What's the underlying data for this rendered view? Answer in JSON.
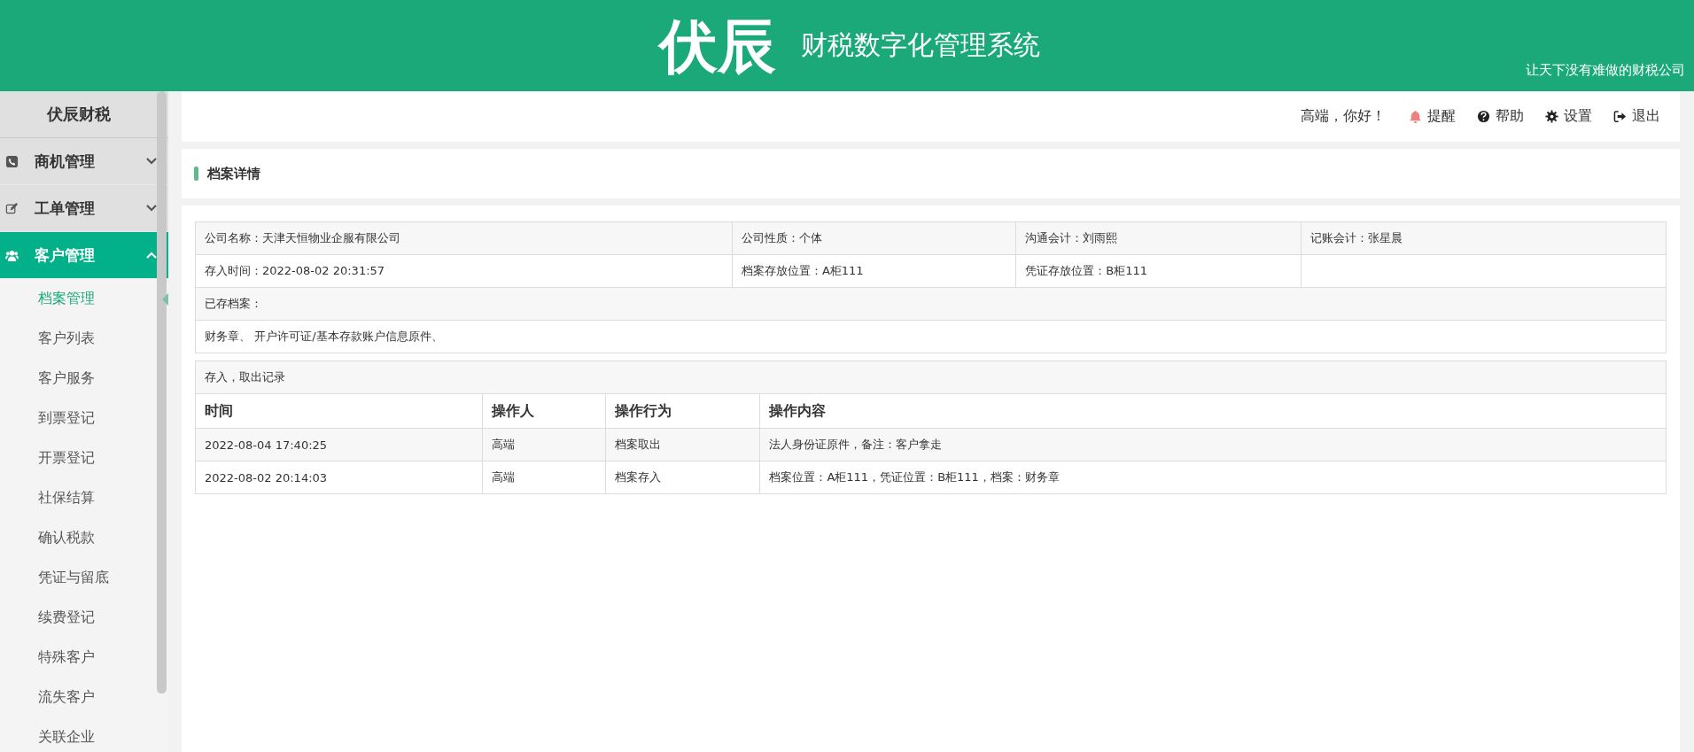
{
  "header": {
    "logo": "伏辰",
    "system_name": "财税数字化管理系统",
    "slogan": "让天下没有难做的财税公司"
  },
  "sidebar": {
    "title": "伏辰财税",
    "groups": [
      {
        "label": "商机管理",
        "kind": "phone",
        "expanded": false
      },
      {
        "label": "工单管理",
        "kind": "edit",
        "expanded": false
      },
      {
        "label": "客户管理",
        "kind": "users",
        "expanded": true,
        "children": [
          {
            "label": "档案管理",
            "selected": true
          },
          {
            "label": "客户列表",
            "selected": false
          },
          {
            "label": "客户服务",
            "selected": false
          },
          {
            "label": "到票登记",
            "selected": false
          },
          {
            "label": "开票登记",
            "selected": false
          },
          {
            "label": "社保结算",
            "selected": false
          },
          {
            "label": "确认税款",
            "selected": false
          },
          {
            "label": "凭证与留底",
            "selected": false
          },
          {
            "label": "续费登记",
            "selected": false
          },
          {
            "label": "特殊客户",
            "selected": false
          },
          {
            "label": "流失客户",
            "selected": false
          },
          {
            "label": "关联企业",
            "selected": false
          }
        ]
      }
    ]
  },
  "topbar": {
    "greeting": "高端，你好！",
    "actions": [
      {
        "label": "提醒",
        "kind": "bell"
      },
      {
        "label": "帮助",
        "kind": "help"
      },
      {
        "label": "设置",
        "kind": "settings"
      },
      {
        "label": "退出",
        "kind": "logout"
      }
    ]
  },
  "section_title": "档案详情",
  "info_table": {
    "rows": [
      [
        "公司名称：天津天恒物业企服有限公司",
        "公司性质：个体",
        "沟通会计：刘雨熙",
        "记账会计：张星晨"
      ],
      [
        "存入时间：2022-08-02 20:31:57",
        "档案存放位置：A柜111",
        "凭证存放位置：B柜111"
      ]
    ],
    "archives_label": "已存档案：",
    "archives_value": "财务章、 开户许可证/基本存款账户信息原件、"
  },
  "records": {
    "title": "存入，取出记录",
    "columns": [
      "时间",
      "操作人",
      "操作行为",
      "操作内容"
    ],
    "rows": [
      [
        "2022-08-04 17:40:25",
        "高端",
        "档案取出",
        "法人身份证原件，备注：客户拿走"
      ],
      [
        "2022-08-02 20:14:03",
        "高端",
        "档案存入",
        "档案位置：A柜111，凭证位置：B柜111，档案：财务章"
      ]
    ]
  }
}
